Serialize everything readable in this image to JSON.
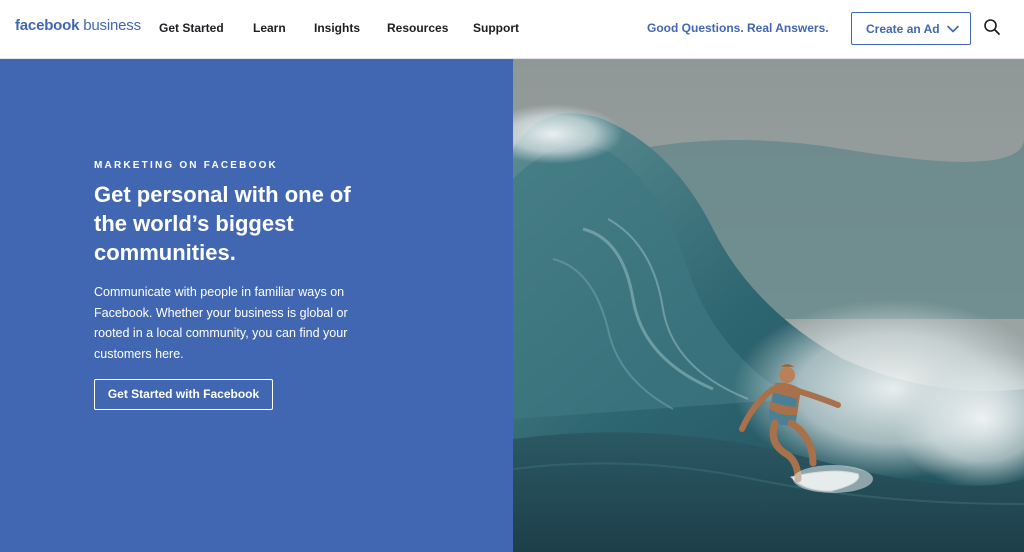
{
  "nav": {
    "brand_bold": "facebook",
    "brand_light": "business",
    "links": [
      "Get Started",
      "Learn",
      "Insights",
      "Resources",
      "Support"
    ],
    "tagline": "Good Questions. Real Answers.",
    "cta_label": "Create an Ad",
    "cta_icon": "chevron-down-icon",
    "search_icon": "search-icon"
  },
  "hero": {
    "eyebrow": "MARKETING ON FACEBOOK",
    "headline": "Get personal with one of the world’s biggest communities.",
    "body": "Communicate with people in familiar ways on Facebook. Whether your business is global or rooted in a local community, you can find your customers here.",
    "button_label": "Get Started with Facebook"
  },
  "colors": {
    "brand_blue": "#4267b2",
    "text_dark": "#1c1e21",
    "white": "#ffffff"
  }
}
